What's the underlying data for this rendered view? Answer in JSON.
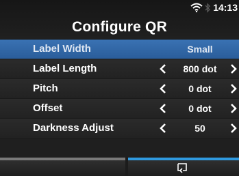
{
  "header": {
    "title": "Configure QR",
    "clock": "14:13",
    "wifi_icon": "wifi-icon",
    "bluetooth_icon": "bluetooth-icon"
  },
  "menu": {
    "items": [
      {
        "label": "Label Width",
        "value": "Small",
        "has_arrows": false,
        "selected": true
      },
      {
        "label": "Label Length",
        "value": "800 dot",
        "has_arrows": true,
        "selected": false
      },
      {
        "label": "Pitch",
        "value": "0 dot",
        "has_arrows": true,
        "selected": false
      },
      {
        "label": "Offset",
        "value": "0 dot",
        "has_arrows": true,
        "selected": false
      },
      {
        "label": "Darkness Adjust",
        "value": "50",
        "has_arrows": true,
        "selected": false
      }
    ]
  },
  "softkeys": {
    "left": {
      "icon": "",
      "color": "#7a7a7a"
    },
    "right": {
      "icon": "enter-icon",
      "color": "#2f9ae0"
    }
  },
  "colors": {
    "selected_row": "#3a72b3",
    "accent": "#2f9ae0"
  }
}
